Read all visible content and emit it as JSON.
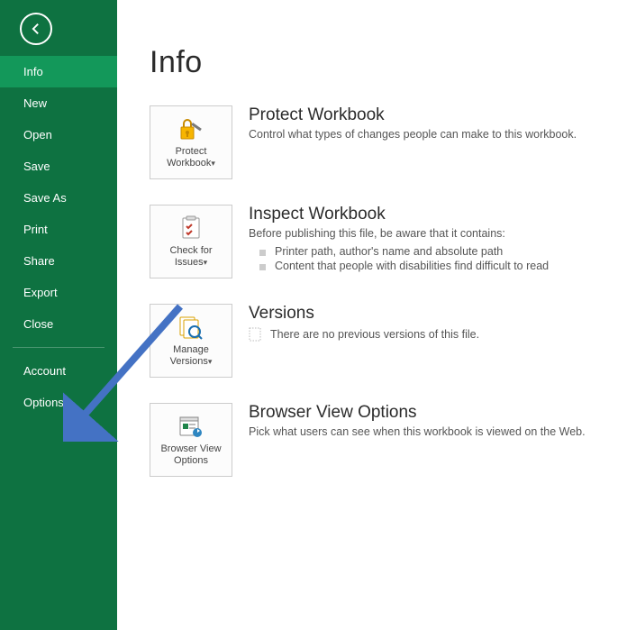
{
  "sidebar": {
    "items": [
      {
        "id": "info",
        "label": "Info",
        "active": true
      },
      {
        "id": "new",
        "label": "New",
        "active": false
      },
      {
        "id": "open",
        "label": "Open",
        "active": false
      },
      {
        "id": "save",
        "label": "Save",
        "active": false
      },
      {
        "id": "saveas",
        "label": "Save As",
        "active": false
      },
      {
        "id": "print",
        "label": "Print",
        "active": false
      },
      {
        "id": "share",
        "label": "Share",
        "active": false
      },
      {
        "id": "export",
        "label": "Export",
        "active": false
      },
      {
        "id": "close",
        "label": "Close",
        "active": false
      }
    ],
    "footer": [
      {
        "id": "account",
        "label": "Account"
      },
      {
        "id": "options",
        "label": "Options"
      }
    ]
  },
  "page": {
    "title": "Info"
  },
  "sections": {
    "protect": {
      "tile_label": "Protect\nWorkbook",
      "tile_caret": "▾",
      "title": "Protect Workbook",
      "desc": "Control what types of changes people can make to this workbook."
    },
    "inspect": {
      "tile_label": "Check for\nIssues",
      "tile_caret": "▾",
      "title": "Inspect Workbook",
      "desc": "Before publishing this file, be aware that it contains:",
      "bullets": [
        "Printer path, author's name and absolute path",
        "Content that people with disabilities find difficult to read"
      ]
    },
    "versions": {
      "tile_label": "Manage\nVersions",
      "tile_caret": "▾",
      "title": "Versions",
      "desc": "There are no previous versions of this file."
    },
    "browser": {
      "tile_label": "Browser View\nOptions",
      "title": "Browser View Options",
      "desc": "Pick what users can see when this workbook is viewed on the Web."
    }
  },
  "colors": {
    "accent": "#0e7241",
    "accent_light": "#13985a",
    "arrow": "#4472c4"
  }
}
